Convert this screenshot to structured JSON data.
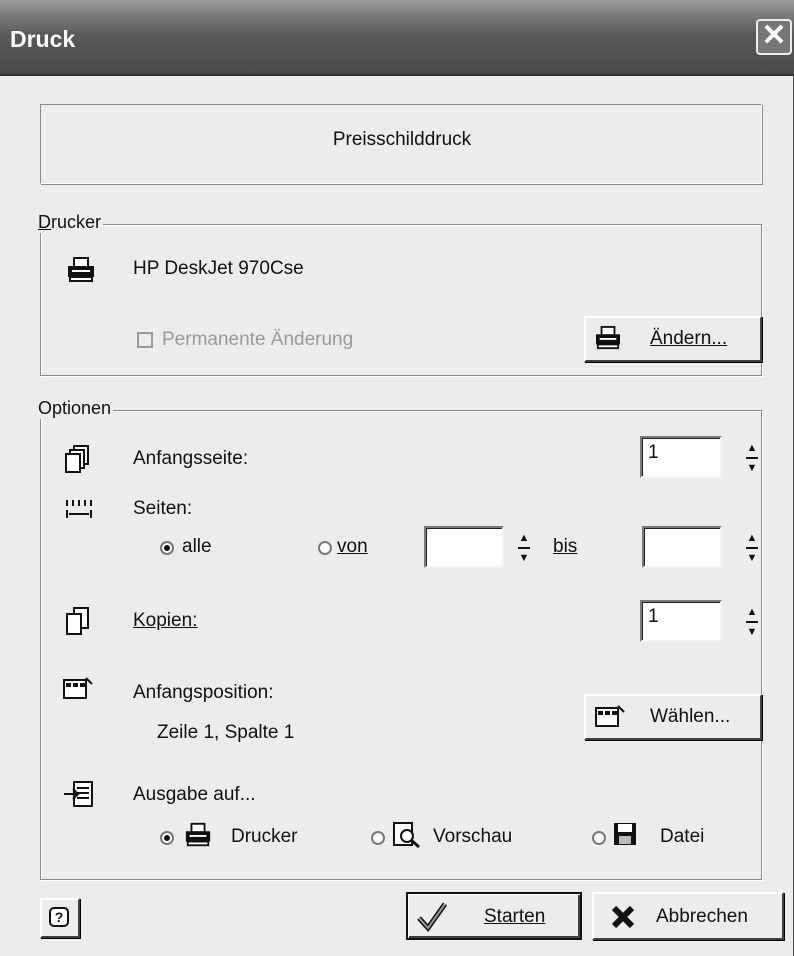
{
  "window": {
    "title": "Druck",
    "close_glyph": "✕"
  },
  "header": {
    "text": "Preisschilddruck"
  },
  "printer_group": {
    "label": "Drucker",
    "printer_name": "HP DeskJet 970Cse",
    "permanent_change_label": "Permanente Änderung",
    "permanent_change_checked": false,
    "change_button_label": "Ändern..."
  },
  "options_group": {
    "label": "Optionen",
    "start_page": {
      "label": "Anfangsseite:",
      "value": "1"
    },
    "pages": {
      "label": "Seiten:",
      "all_label": "alle",
      "from_label": "von",
      "from_value": "",
      "to_label": "bis",
      "to_value": "",
      "selected": "alle"
    },
    "copies": {
      "label": "Kopien:",
      "value": "1"
    },
    "start_position": {
      "label": "Anfangsposition:",
      "value": "Zeile 1, Spalte 1",
      "choose_button_label": "Wählen..."
    },
    "output": {
      "label": "Ausgabe auf...",
      "printer_label": "Drucker",
      "preview_label": "Vorschau",
      "file_label": "Datei",
      "selected": "Drucker"
    }
  },
  "footer": {
    "help_glyph": "?",
    "start_button_label": "Starten",
    "cancel_button_label": "Abbrechen"
  },
  "icons": [
    "printer-icon",
    "pages-icon",
    "page-range-icon",
    "copies-icon",
    "grid-position-icon",
    "output-icon",
    "preview-icon",
    "floppy-disk-icon",
    "checkmark-icon",
    "cross-icon",
    "help-icon",
    "spin-arrows-icon"
  ]
}
